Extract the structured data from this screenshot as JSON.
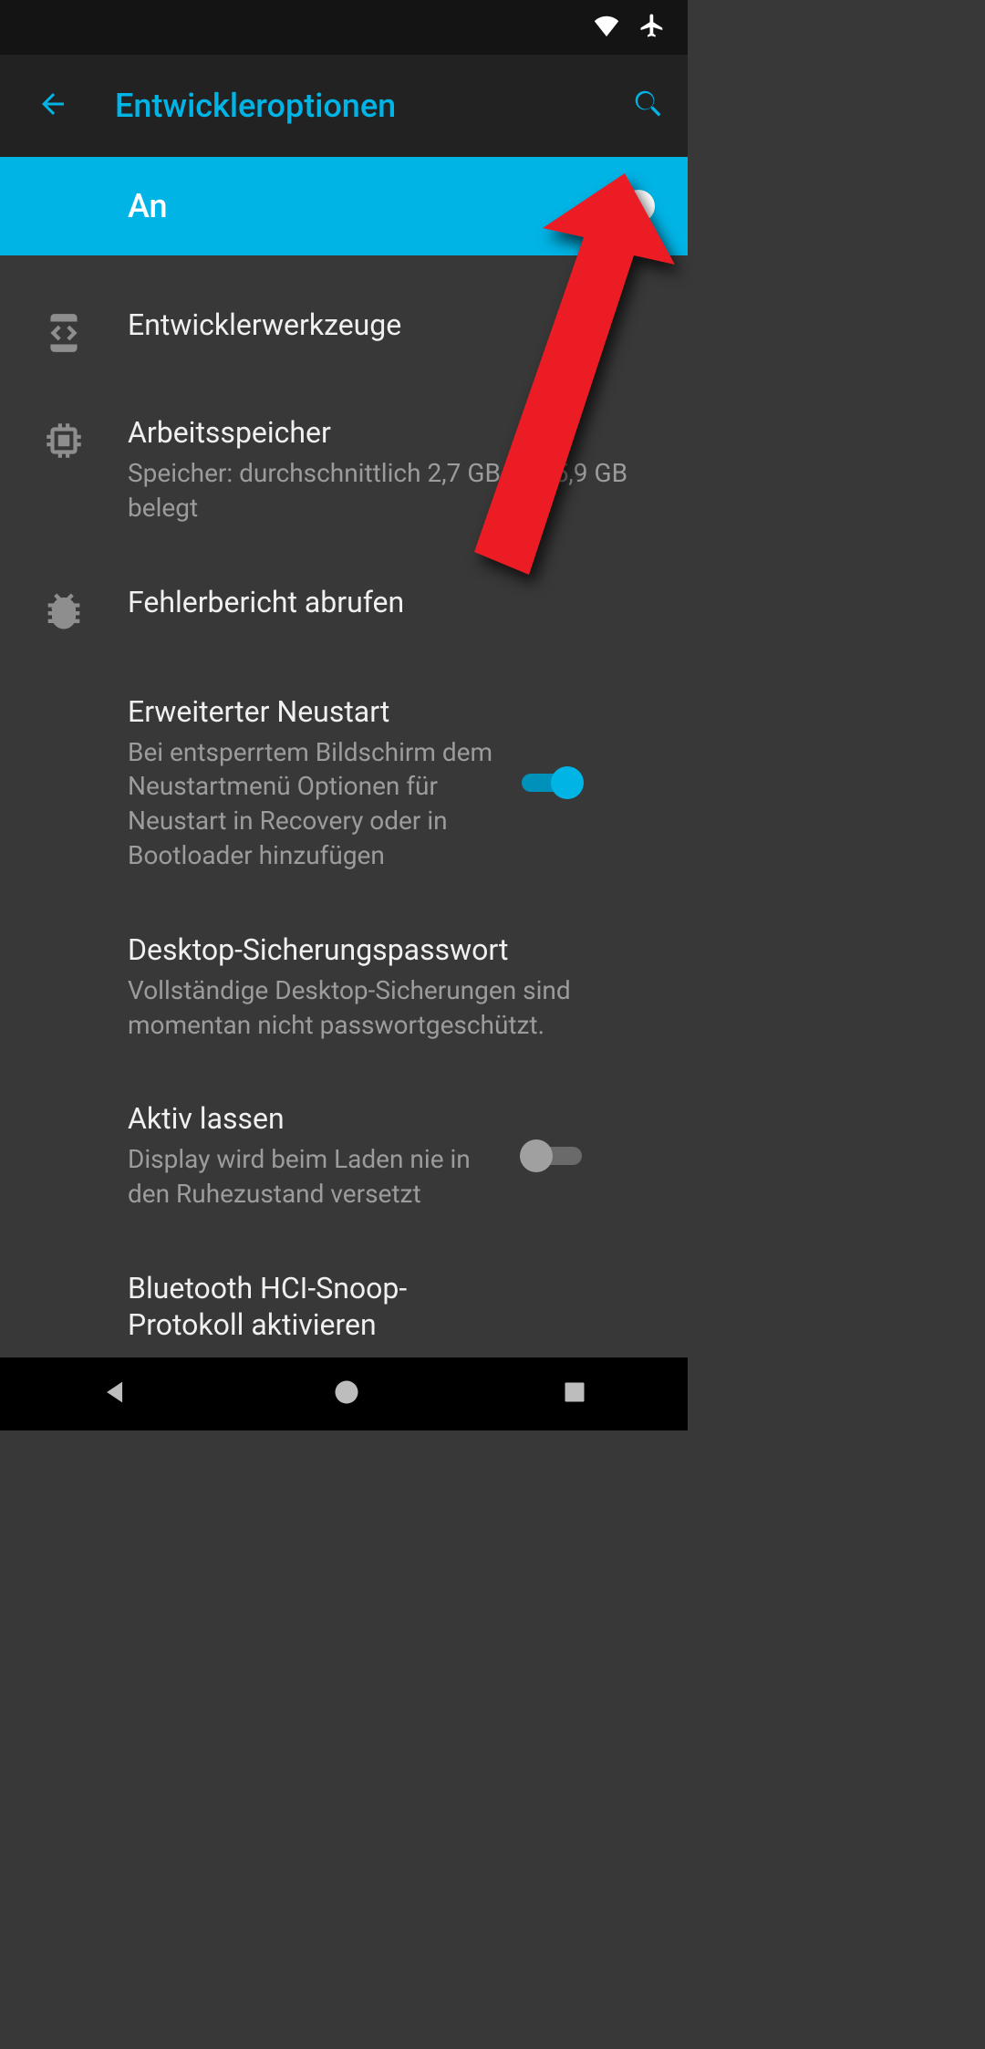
{
  "colors": {
    "accent": "#00b4e6",
    "annotation": "#ec1c24"
  },
  "status_bar": {
    "wifi_icon": "wifi-icon",
    "airplane_icon": "airplane-mode-icon"
  },
  "app_bar": {
    "title": "Entwickleroptionen"
  },
  "master": {
    "label": "An",
    "on": true
  },
  "rows": [
    {
      "id": "dev-tools",
      "icon": "developer-mode-icon",
      "title": "Entwicklerwerkzeuge",
      "sub": null,
      "toggle": null
    },
    {
      "id": "memory",
      "icon": "memory-chip-icon",
      "title": "Arbeitsspeicher",
      "sub": "Speicher: durchschnittlich 2,7 GB von 5,9 GB belegt",
      "toggle": null
    },
    {
      "id": "bug-report",
      "icon": "bug-icon",
      "title": "Fehlerbericht abrufen",
      "sub": null,
      "toggle": null
    },
    {
      "id": "advanced-restart",
      "icon": null,
      "title": "Erweiterter Neustart",
      "sub": "Bei entsperrtem Bildschirm dem Neustartmenü Optionen für Neustart in Recovery oder in Bootloader hinzufügen",
      "toggle": true
    },
    {
      "id": "desktop-backup-pw",
      "icon": null,
      "title": "Desktop-Sicherungspasswort",
      "sub": "Vollständige Desktop-Sicherungen sind momentan nicht passwortgeschützt.",
      "toggle": null
    },
    {
      "id": "stay-awake",
      "icon": null,
      "title": "Aktiv lassen",
      "sub": "Display wird beim Laden nie in den Ruhezustand versetzt",
      "toggle": false
    },
    {
      "id": "bt-hci-snoop",
      "icon": null,
      "title": "Bluetooth HCI-Snoop-Protokoll aktivieren",
      "sub": null,
      "toggle": null
    }
  ],
  "nav_bar": {
    "back": "nav-back",
    "home": "nav-home",
    "recent": "nav-recent"
  }
}
